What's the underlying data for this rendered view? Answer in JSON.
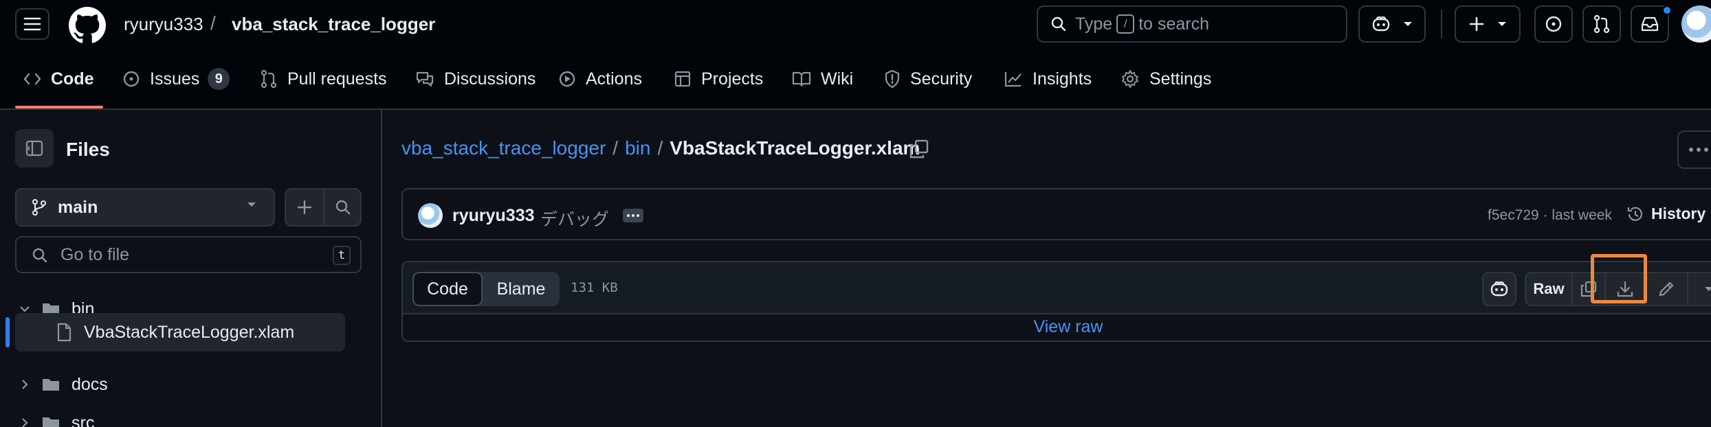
{
  "header": {
    "owner": "ryuryu333",
    "separator": "/",
    "repo": "vba_stack_trace_logger",
    "search_prefix": "Type",
    "search_key": "/",
    "search_suffix": "to search"
  },
  "nav": {
    "tabs": [
      {
        "label": "Code",
        "active": true
      },
      {
        "label": "Issues",
        "count": "9"
      },
      {
        "label": "Pull requests"
      },
      {
        "label": "Discussions"
      },
      {
        "label": "Actions"
      },
      {
        "label": "Projects"
      },
      {
        "label": "Wiki"
      },
      {
        "label": "Security"
      },
      {
        "label": "Insights"
      },
      {
        "label": "Settings"
      }
    ]
  },
  "sidebar": {
    "title": "Files",
    "branch": "main",
    "goto_placeholder": "Go to file",
    "goto_key": "t",
    "tree": [
      {
        "label": "bin",
        "type": "folder",
        "expanded": true
      },
      {
        "label": "VbaStackTraceLogger.xlam",
        "type": "file",
        "selected": true
      },
      {
        "label": "docs",
        "type": "folder"
      },
      {
        "label": "src",
        "type": "folder"
      }
    ]
  },
  "breadcrumb": {
    "repo": "vba_stack_trace_logger",
    "sep": "/",
    "dir": "bin",
    "file": "VbaStackTraceLogger.xlam"
  },
  "commit": {
    "author": "ryuryu333",
    "message": "デバッグ",
    "meta": "f5ec729 · last week",
    "history": "History"
  },
  "file": {
    "tab_code": "Code",
    "tab_blame": "Blame",
    "size": "131 KB",
    "raw": "Raw",
    "view_raw": "View raw"
  },
  "colors": {
    "accent": "#f78166",
    "link": "#4493f8",
    "highlight": "#f0883e"
  }
}
